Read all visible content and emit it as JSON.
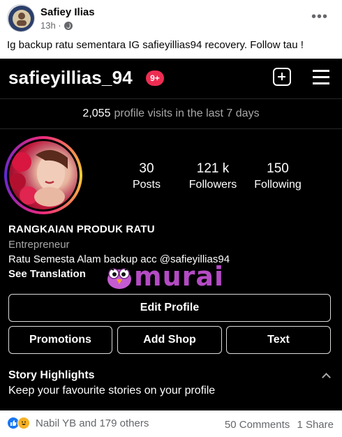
{
  "post": {
    "author": "Safiey Ilias",
    "time": "13h · ",
    "more": "•••",
    "text": "Ig backup ratu sementara IG safieyillias94 recovery. Follow tau !"
  },
  "instagram": {
    "username": "safieyillias_94",
    "notifications": "9+",
    "visits_count": "2,055",
    "visits_label": "profile visits in the last 7 days",
    "stats": [
      {
        "num": "30",
        "label": "Posts"
      },
      {
        "num": "121 k",
        "label": "Followers"
      },
      {
        "num": "150",
        "label": "Following"
      }
    ],
    "bio_name": "RANGKAIAN PRODUK RATU",
    "bio_category": "Entrepreneur",
    "bio_text": "Ratu Semesta Alam backup acc @safieyillias94",
    "see_translation": "See Translation",
    "watermark": "murai",
    "edit_profile": "Edit Profile",
    "buttons": [
      "Promotions",
      "Add Shop",
      "Text"
    ],
    "highlights_title": "Story Highlights",
    "highlights_sub": "Keep your favourite stories on your profile"
  },
  "footer": {
    "reactors": "Nabil YB and 179 others",
    "comments": "50 Comments",
    "shares": "1 Share"
  },
  "colors": {
    "ig_background": "#000000",
    "notification_badge": "#ed2d52",
    "watermark": "#b44bc4",
    "fb_like": "#1877f2",
    "fb_haha": "#f7b125"
  }
}
